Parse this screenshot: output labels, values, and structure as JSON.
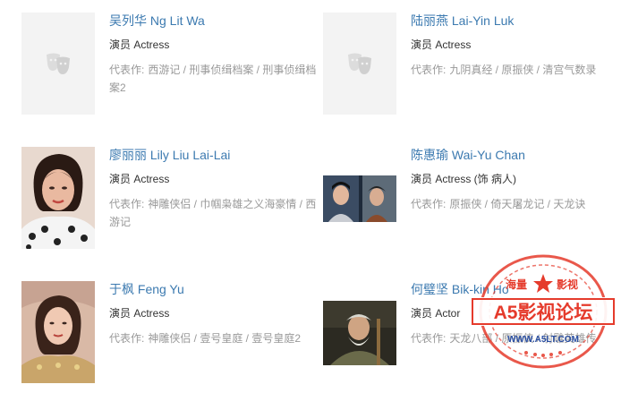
{
  "cast": [
    {
      "name": "吴列华 Ng Lit Wa",
      "role": "演员 Actress",
      "works_label": "代表作:",
      "works": "西游记 / 刑事侦缉档案 / 刑事侦缉档案2",
      "photo": "placeholder"
    },
    {
      "name": "陆丽燕 Lai-Yin Luk",
      "role": "演员 Actress",
      "works_label": "代表作:",
      "works": "九阴真经 / 原振侠 / 清宫气数录",
      "photo": "placeholder"
    },
    {
      "name": "廖丽丽 Lily Liu Lai-Lai",
      "role": "演员 Actress",
      "works_label": "代表作:",
      "works": "神雕侠侣 / 巾帼枭雄之义海豪情 / 西游记",
      "photo": "portrait"
    },
    {
      "name": "陈惠瑜 Wai-Yu Chan",
      "role": "演员 Actress (饰 病人)",
      "works_label": "代表作:",
      "works": "原振侠 / 倚天屠龙记 / 天龙诀",
      "photo": "still"
    },
    {
      "name": "于枫 Feng Yu",
      "role": "演员 Actress",
      "works_label": "代表作:",
      "works": "神雕侠侣 / 壹号皇庭 / 壹号皇庭2",
      "photo": "portrait"
    },
    {
      "name": "何璧坚 Bik-kin Ho",
      "role": "演员 Actor",
      "works_label": "代表作:",
      "works": "天龙八部 / 原振侠 / 射雕英雄传",
      "photo": "still"
    }
  ],
  "watermark": {
    "top_left": "海量",
    "top_right": "影视",
    "title": "A5影视论坛",
    "url": "WWW.A5LT.COM",
    "color": "#e53b2c"
  },
  "colors": {
    "link": "#3c7ab0",
    "muted": "#999999",
    "text": "#333333"
  }
}
